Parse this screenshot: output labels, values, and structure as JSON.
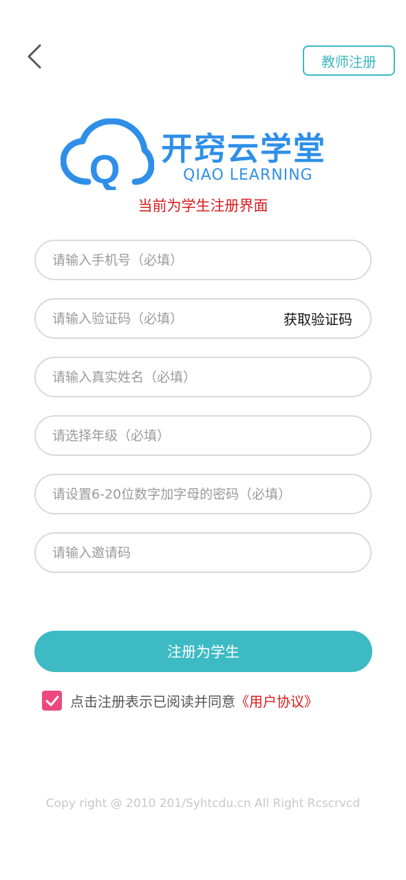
{
  "header": {
    "teacher_register_label": "教师注册"
  },
  "logo": {
    "name_cn": "开窍云学堂",
    "name_en": "QIAO LEARNING",
    "mark_letter": "Q",
    "color": "#2f8fe8"
  },
  "subtitle": "当前为学生注册界面",
  "form": {
    "phone_placeholder": "请输入手机号（必填）",
    "code_placeholder": "请输入验证码（必填）",
    "get_code_label": "获取验证码",
    "name_placeholder": "请输入真实姓名（必填）",
    "grade_placeholder": "请选择年级（必填）",
    "password_placeholder": "请设置6-20位数字加字母的密码（必填）",
    "invite_placeholder": "请输入邀请码"
  },
  "register_label": "注册为学生",
  "agreement": {
    "checked": true,
    "text": "点击注册表示已阅读并同意",
    "link": "《用户协议》"
  },
  "copyright": "Copy right @ 2010 201/Syhtcdu.cn All Right Rcscrvcd",
  "colors": {
    "accent": "#3dbac4",
    "brand": "#2f8fe8",
    "warning": "#d81c1c",
    "checkbox": "#ec4a7e"
  }
}
